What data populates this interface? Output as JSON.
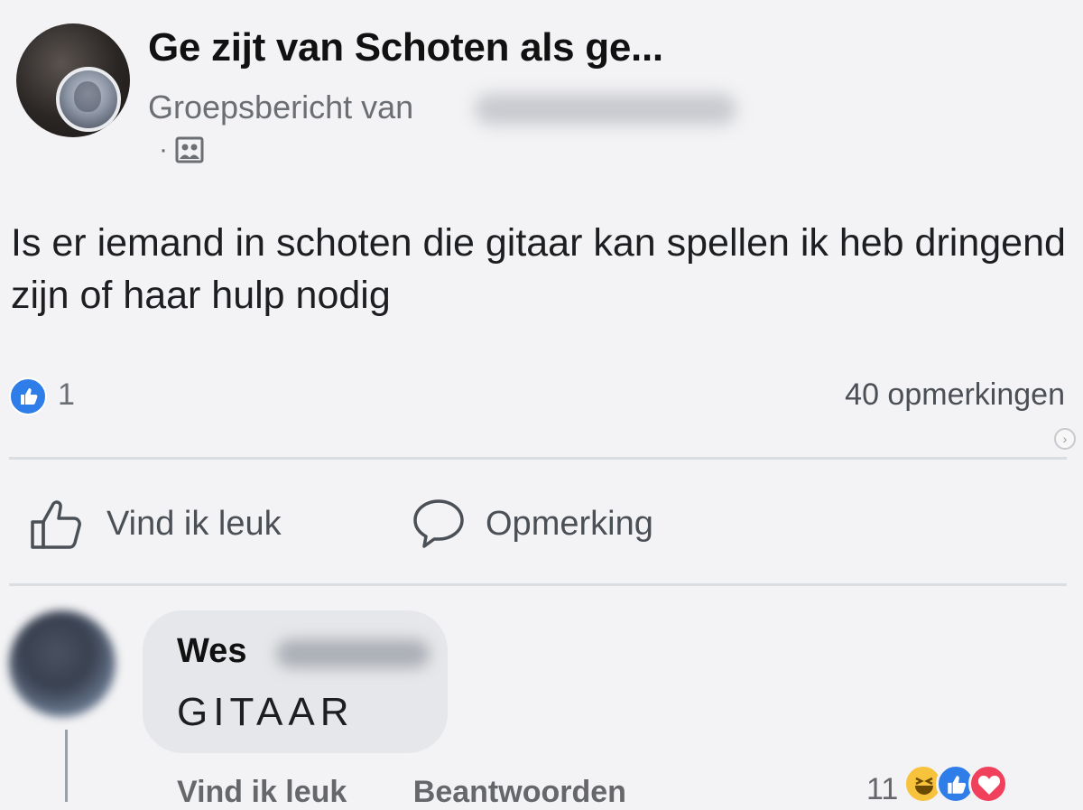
{
  "post": {
    "group_name": "Ge zijt van Schoten als ge...",
    "subtitle": "Groepsbericht van",
    "privacy_dot": "·",
    "text": "Is er iemand in schoten die gitaar kan spellen ik heb dringend zijn of haar hulp nodig"
  },
  "stats": {
    "likes": "1",
    "comments": "40 opmerkingen"
  },
  "actions": {
    "like": "Vind ik leuk",
    "comment": "Opmerking"
  },
  "comment": {
    "author": "Wes",
    "text": "GITAAR",
    "like": "Vind ik leuk",
    "reply": "Beantwoorden",
    "reaction_count": "11",
    "reactions": [
      "haha",
      "like",
      "love"
    ]
  },
  "colors": {
    "like_blue": "#2e7de9",
    "haha_yellow": "#f7c23c",
    "love_red": "#f0405c",
    "background": "#f3f3f5"
  },
  "icons": {
    "privacy": "group-icon",
    "like_action": "thumbs-up-outline-icon",
    "comment_action": "speech-bubble-icon",
    "like_badge": "thumbs-up-icon"
  }
}
